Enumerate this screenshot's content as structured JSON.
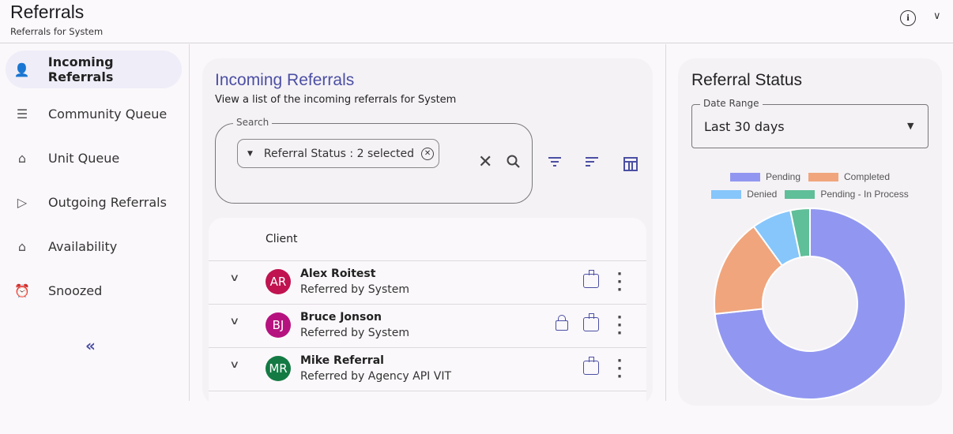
{
  "header": {
    "title": "Referrals",
    "subtitle": "Referrals for System"
  },
  "sidebar": {
    "items": [
      {
        "label": "Incoming Referrals",
        "icon": "person-add-icon",
        "glyph": "👤",
        "active": true
      },
      {
        "label": "Community Queue",
        "icon": "queue-person-icon",
        "glyph": "☰"
      },
      {
        "label": "Unit Queue",
        "icon": "building-icon",
        "glyph": "⌂"
      },
      {
        "label": "Outgoing Referrals",
        "icon": "send-icon",
        "glyph": "▷"
      },
      {
        "label": "Availability",
        "icon": "home-check-icon",
        "glyph": "⌂"
      },
      {
        "label": "Snoozed",
        "icon": "snooze-alarm-icon",
        "glyph": "⏰"
      }
    ],
    "collapse": "«"
  },
  "main": {
    "title": "Incoming Referrals",
    "subtitle": "View a list of the incoming referrals for System",
    "search": {
      "label": "Search",
      "chip": "Referral Status :  2 selected"
    },
    "table": {
      "header": "Client",
      "rows": [
        {
          "initials": "AR",
          "name": "Alex Roitest",
          "referred_by": "Referred by System",
          "color": "#c0134f",
          "locked": false
        },
        {
          "initials": "BJ",
          "name": "Bruce Jonson",
          "referred_by": "Referred by System",
          "color": "#b5127f",
          "locked": true
        },
        {
          "initials": "MR",
          "name": "Mike Referral",
          "referred_by": "Referred by Agency API VIT",
          "color": "#147a44",
          "locked": false
        }
      ]
    }
  },
  "status": {
    "title": "Referral Status",
    "date_range": {
      "label": "Date Range",
      "value": "Last 30 days"
    }
  },
  "chart_data": {
    "type": "pie",
    "variant": "donut",
    "labels": [
      "Pending",
      "Completed",
      "Denied",
      "Pending - In Process"
    ],
    "values": [
      73.3,
      16.7,
      6.7,
      3.3
    ],
    "unit": "percent (estimated)",
    "colors": [
      "#9197f0",
      "#f0a57c",
      "#86c6fb",
      "#5fbf98"
    ],
    "legend": "top"
  }
}
